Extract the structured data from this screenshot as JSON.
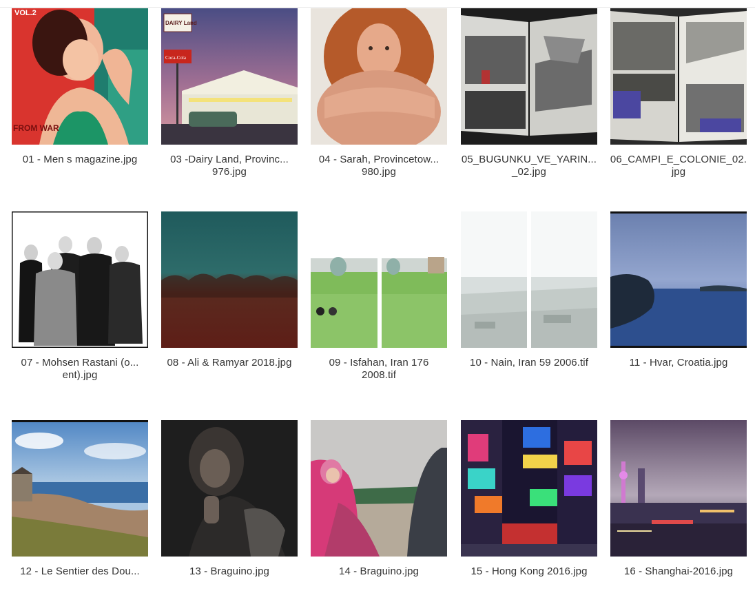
{
  "gallery": {
    "items": [
      {
        "line1": "01 - Men s magazine.jpg",
        "line2": ""
      },
      {
        "line1": "03 -Dairy Land, Provinc...",
        "line2": "976.jpg"
      },
      {
        "line1": "04 - Sarah, Provincetow...",
        "line2": "980.jpg"
      },
      {
        "line1": "05_BUGUNKU_VE_YARIN...",
        "line2": "_02.jpg"
      },
      {
        "line1": "06_CAMPI_E_COLONIE_02.",
        "line2": "jpg"
      },
      {
        "line1": "07 - Mohsen Rastani (o...",
        "line2": "ent).jpg"
      },
      {
        "line1": "08 - Ali & Ramyar 2018.jpg",
        "line2": ""
      },
      {
        "line1": "09 - Isfahan, Iran 176",
        "line2": "2008.tif"
      },
      {
        "line1": "10 - Nain, Iran 59 2006.tif",
        "line2": ""
      },
      {
        "line1": "11 - Hvar, Croatia.jpg",
        "line2": ""
      },
      {
        "line1": "12 - Le Sentier des Dou...",
        "line2": ""
      },
      {
        "line1": "13 - Braguino.jpg",
        "line2": ""
      },
      {
        "line1": "14 - Braguino.jpg",
        "line2": ""
      },
      {
        "line1": "15 - Hong Kong 2016.jpg",
        "line2": ""
      },
      {
        "line1": "16 - Shanghai-2016.jpg",
        "line2": ""
      }
    ],
    "thumb_signs": {
      "dairy_sign": "DAIRY Land",
      "coke_sign": "Coca-Cola",
      "magazine_vol": "VOL.2",
      "magazine_war": "FROM WAR"
    }
  }
}
